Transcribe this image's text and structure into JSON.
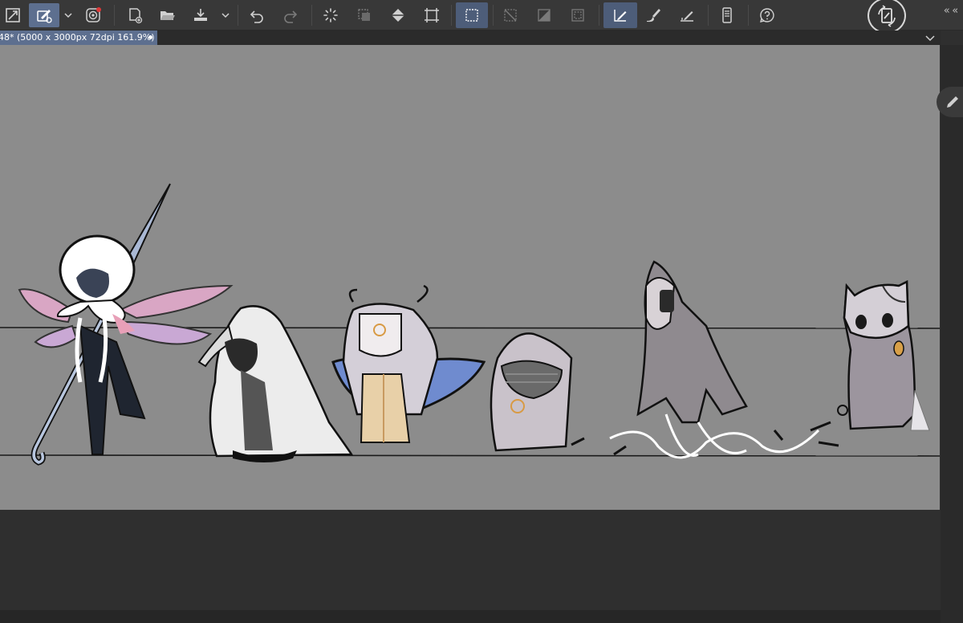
{
  "document": {
    "tab_title": "48* (5000 x 3000px 72dpi 161.9%)"
  },
  "toolbar": {
    "items": [
      {
        "name": "fit-canvas-icon"
      },
      {
        "name": "pen-settings-icon",
        "active": true
      },
      {
        "name": "dropdown-chevron-icon"
      },
      {
        "name": "spiral-app-icon"
      },
      {
        "name": "new-file-icon"
      },
      {
        "name": "open-folder-icon"
      },
      {
        "name": "save-tray-icon"
      },
      {
        "name": "undo-icon"
      },
      {
        "name": "redo-icon"
      },
      {
        "name": "transform-busy-icon"
      },
      {
        "name": "selection-layer-icon"
      },
      {
        "name": "fill-bucket-icon"
      },
      {
        "name": "crop-icon"
      },
      {
        "name": "selection-rect-icon",
        "selected": true
      },
      {
        "name": "clear-selection-icon"
      },
      {
        "name": "invert-selection-icon"
      },
      {
        "name": "selection-border-icon"
      },
      {
        "name": "ruler-pen-icon",
        "selected": true
      },
      {
        "name": "brush-icon"
      },
      {
        "name": "angle-ruler-icon"
      },
      {
        "name": "smartphone-icon"
      },
      {
        "name": "help-icon"
      }
    ]
  },
  "colors": {
    "toolbar_bg": "#383838",
    "accent": "#5d6f8f",
    "canvas_bg": "#8c8c8c",
    "workspace_bg": "#2f2f2f",
    "icon": "#d0d0d0"
  }
}
